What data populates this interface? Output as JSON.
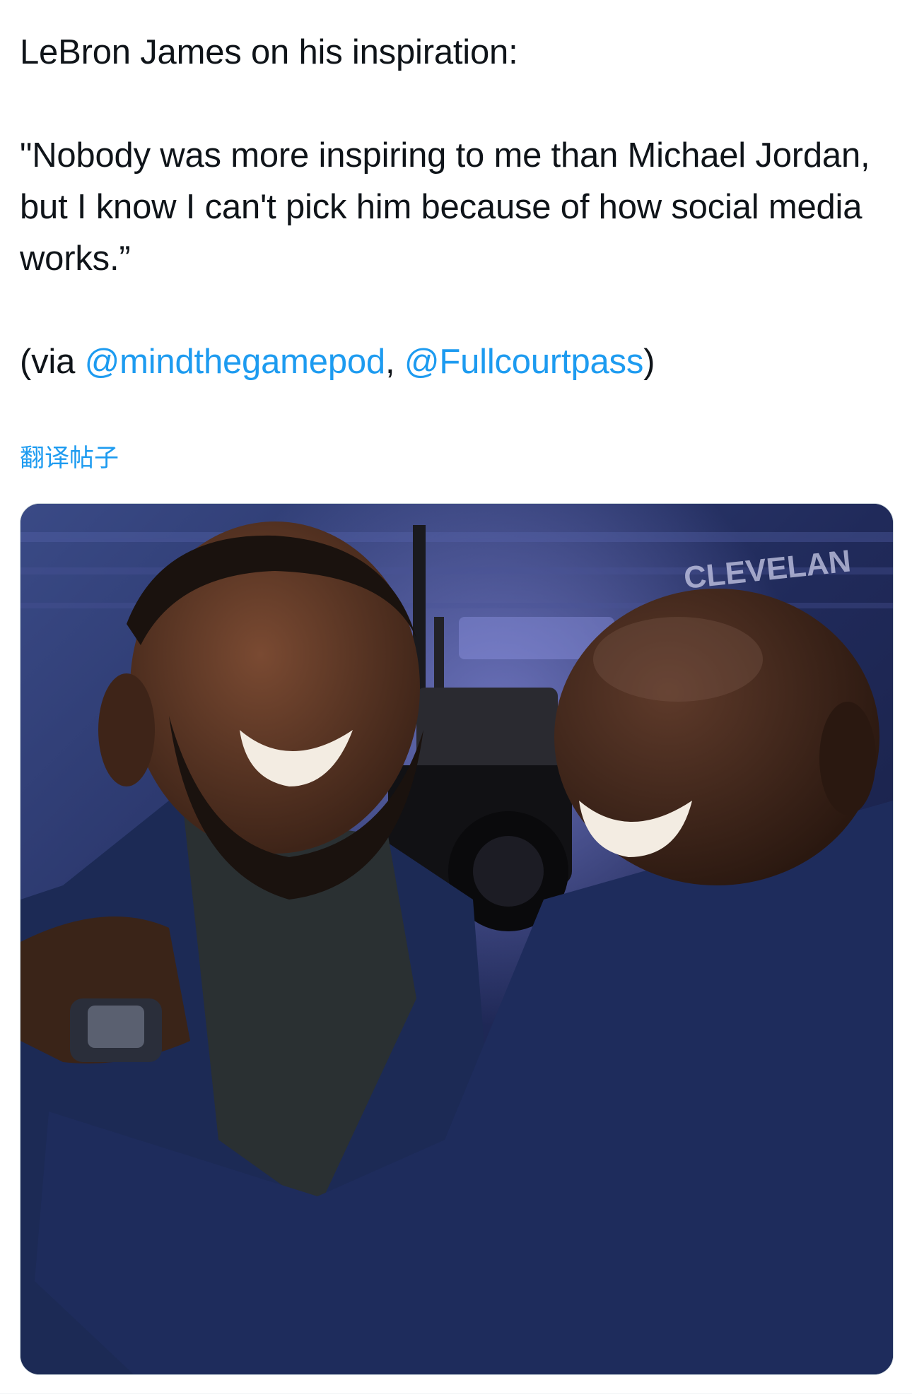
{
  "tweet": {
    "line1": "LeBron James on his inspiration:",
    "quote": "\"Nobody was more inspiring to me than Michael Jordan, but I know I can't pick him because of how social media works.”",
    "via_prefix": "(via ",
    "mention1": "@mindthegamepod",
    "separator": ", ",
    "mention2": "@Fullcourtpass",
    "via_suffix": ")"
  },
  "translate_label": "翻译帖子",
  "media": {
    "description": "LeBron James and Michael Jordan laughing and embracing courtside",
    "arena_sign": "CLEVELAN"
  },
  "colors": {
    "text": "#0f1419",
    "link": "#1d9bf0",
    "suit": "#1c2a55",
    "background_arena": "#2a3468"
  }
}
